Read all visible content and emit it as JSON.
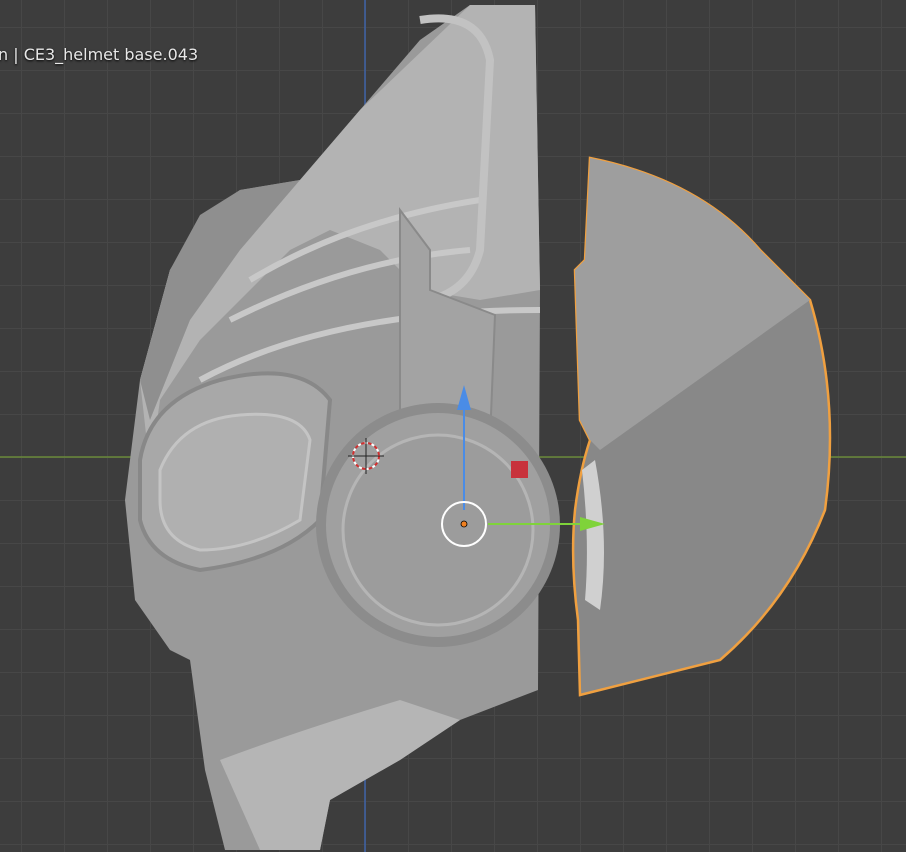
{
  "viewport": {
    "object_info": "n | CE3_helmet base.043",
    "colors": {
      "background": "#3d3d3d",
      "grid": "#474747",
      "x_axis": "#6a8a3a",
      "z_axis": "#3f63a8",
      "selection_outline": "#f0a040",
      "gizmo_x": "#7fd33a",
      "gizmo_z": "#4a8ce6",
      "gizmo_y_handle": "#c8323c"
    }
  }
}
